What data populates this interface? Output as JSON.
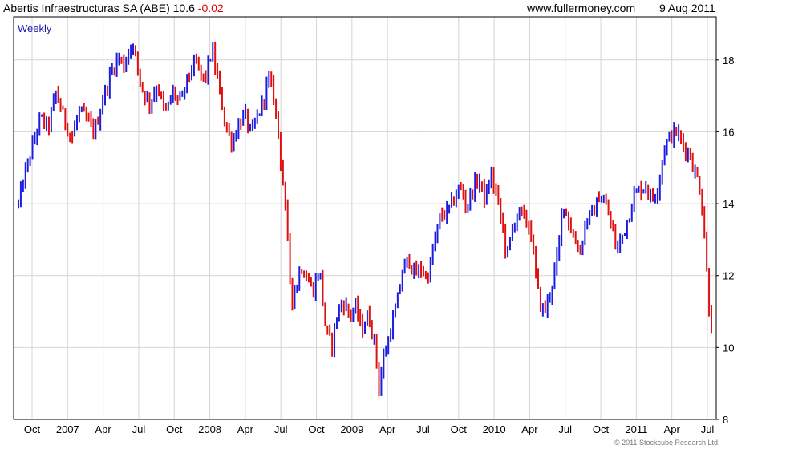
{
  "header": {
    "title": "Abertis Infraestructuras SA (ABE) 10.6",
    "change": "-0.02",
    "site": "www.fullermoney.com",
    "date": "9 Aug 2011"
  },
  "chart_data": {
    "type": "bar",
    "period_label": "Weekly",
    "ylim": [
      8,
      19.2
    ],
    "y_ticks": [
      8,
      10,
      12,
      14,
      16,
      18
    ],
    "x_ticks": [
      "Oct",
      "2007",
      "Apr",
      "Jul",
      "Oct",
      "2008",
      "Apr",
      "Jul",
      "Oct",
      "2009",
      "Apr",
      "Jul",
      "Oct",
      "2010",
      "Apr",
      "Jul",
      "Oct",
      "2011",
      "Apr",
      "Jul"
    ],
    "grid": true,
    "up_color": "#1c1ce0",
    "down_color": "#e01010",
    "copyright": "© 2011 Stockcube Research Ltd",
    "series": [
      {
        "values": [
          {
            "x": 0,
            "y": 14.0
          },
          {
            "x": 8,
            "y": 14.8
          },
          {
            "x": 18,
            "y": 15.6
          },
          {
            "x": 28,
            "y": 16.4
          },
          {
            "x": 38,
            "y": 16.1
          },
          {
            "x": 48,
            "y": 17.1
          },
          {
            "x": 58,
            "y": 16.4
          },
          {
            "x": 68,
            "y": 15.8
          },
          {
            "x": 78,
            "y": 16.6
          },
          {
            "x": 88,
            "y": 16.3
          },
          {
            "x": 98,
            "y": 16.0
          },
          {
            "x": 108,
            "y": 16.9
          },
          {
            "x": 118,
            "y": 17.6
          },
          {
            "x": 128,
            "y": 18.1
          },
          {
            "x": 136,
            "y": 17.8
          },
          {
            "x": 143,
            "y": 18.5
          },
          {
            "x": 150,
            "y": 18.1
          },
          {
            "x": 158,
            "y": 17.2
          },
          {
            "x": 168,
            "y": 16.8
          },
          {
            "x": 178,
            "y": 17.3
          },
          {
            "x": 188,
            "y": 16.5
          },
          {
            "x": 198,
            "y": 17.1
          },
          {
            "x": 208,
            "y": 16.8
          },
          {
            "x": 218,
            "y": 17.6
          },
          {
            "x": 228,
            "y": 17.9
          },
          {
            "x": 238,
            "y": 17.4
          },
          {
            "x": 248,
            "y": 18.3
          },
          {
            "x": 258,
            "y": 17.1
          },
          {
            "x": 266,
            "y": 16.1
          },
          {
            "x": 274,
            "y": 15.7
          },
          {
            "x": 282,
            "y": 16.2
          },
          {
            "x": 290,
            "y": 16.5
          },
          {
            "x": 298,
            "y": 15.9
          },
          {
            "x": 306,
            "y": 16.4
          },
          {
            "x": 314,
            "y": 16.9
          },
          {
            "x": 320,
            "y": 17.5
          },
          {
            "x": 326,
            "y": 17.1
          },
          {
            "x": 332,
            "y": 16.2
          },
          {
            "x": 338,
            "y": 14.8
          },
          {
            "x": 344,
            "y": 13.3
          },
          {
            "x": 350,
            "y": 11.3
          },
          {
            "x": 356,
            "y": 11.7
          },
          {
            "x": 362,
            "y": 12.3
          },
          {
            "x": 370,
            "y": 11.9
          },
          {
            "x": 378,
            "y": 11.6
          },
          {
            "x": 386,
            "y": 12.2
          },
          {
            "x": 394,
            "y": 10.4
          },
          {
            "x": 402,
            "y": 10.1
          },
          {
            "x": 408,
            "y": 10.9
          },
          {
            "x": 416,
            "y": 11.3
          },
          {
            "x": 424,
            "y": 10.9
          },
          {
            "x": 432,
            "y": 11.1
          },
          {
            "x": 440,
            "y": 10.5
          },
          {
            "x": 448,
            "y": 10.9
          },
          {
            "x": 456,
            "y": 10.2
          },
          {
            "x": 462,
            "y": 8.9
          },
          {
            "x": 468,
            "y": 9.7
          },
          {
            "x": 476,
            "y": 10.4
          },
          {
            "x": 484,
            "y": 11.1
          },
          {
            "x": 492,
            "y": 12.1
          },
          {
            "x": 500,
            "y": 12.5
          },
          {
            "x": 508,
            "y": 12.0
          },
          {
            "x": 516,
            "y": 12.2
          },
          {
            "x": 524,
            "y": 11.9
          },
          {
            "x": 532,
            "y": 12.8
          },
          {
            "x": 540,
            "y": 13.6
          },
          {
            "x": 550,
            "y": 13.8
          },
          {
            "x": 558,
            "y": 14.1
          },
          {
            "x": 566,
            "y": 14.5
          },
          {
            "x": 574,
            "y": 13.9
          },
          {
            "x": 582,
            "y": 14.4
          },
          {
            "x": 590,
            "y": 14.7
          },
          {
            "x": 598,
            "y": 14.1
          },
          {
            "x": 606,
            "y": 14.8
          },
          {
            "x": 614,
            "y": 14.1
          },
          {
            "x": 620,
            "y": 13.4
          },
          {
            "x": 626,
            "y": 12.5
          },
          {
            "x": 632,
            "y": 13.2
          },
          {
            "x": 640,
            "y": 13.8
          },
          {
            "x": 648,
            "y": 13.6
          },
          {
            "x": 656,
            "y": 13.3
          },
          {
            "x": 662,
            "y": 12.2
          },
          {
            "x": 668,
            "y": 11.2
          },
          {
            "x": 674,
            "y": 11.0
          },
          {
            "x": 680,
            "y": 11.4
          },
          {
            "x": 686,
            "y": 12.0
          },
          {
            "x": 692,
            "y": 12.7
          },
          {
            "x": 698,
            "y": 14.1
          },
          {
            "x": 704,
            "y": 13.6
          },
          {
            "x": 712,
            "y": 13.0
          },
          {
            "x": 720,
            "y": 12.7
          },
          {
            "x": 728,
            "y": 13.6
          },
          {
            "x": 736,
            "y": 13.7
          },
          {
            "x": 744,
            "y": 14.2
          },
          {
            "x": 752,
            "y": 14.0
          },
          {
            "x": 760,
            "y": 13.4
          },
          {
            "x": 766,
            "y": 12.7
          },
          {
            "x": 772,
            "y": 13.0
          },
          {
            "x": 780,
            "y": 13.5
          },
          {
            "x": 788,
            "y": 14.2
          },
          {
            "x": 796,
            "y": 14.4
          },
          {
            "x": 804,
            "y": 14.5
          },
          {
            "x": 812,
            "y": 14.1
          },
          {
            "x": 820,
            "y": 14.5
          },
          {
            "x": 828,
            "y": 15.6
          },
          {
            "x": 836,
            "y": 15.9
          },
          {
            "x": 844,
            "y": 16.0
          },
          {
            "x": 852,
            "y": 15.6
          },
          {
            "x": 860,
            "y": 15.4
          },
          {
            "x": 866,
            "y": 14.9
          },
          {
            "x": 872,
            "y": 14.6
          },
          {
            "x": 876,
            "y": 13.9
          },
          {
            "x": 880,
            "y": 12.9
          },
          {
            "x": 884,
            "y": 11.3
          },
          {
            "x": 888,
            "y": 10.6
          }
        ]
      }
    ]
  }
}
